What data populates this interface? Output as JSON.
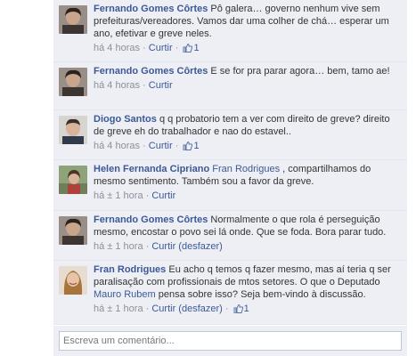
{
  "comments": [
    {
      "author": "Fernando Gomes Côrtes",
      "text": " Pô galera… governo nenhum vive sem prefeituras/vereadores. Vamos dar uma colher de chá… esperar um ano, efetivar e greve neles.",
      "time": "há 4 horas",
      "sep": " · ",
      "action": "Curtir",
      "likes": "1",
      "avatar": "man-dark-hair"
    },
    {
      "author": "Fernando Gomes Côrtes",
      "text": " E se for pra parar agora… bem, tamo ae!",
      "time": "há 4 horas",
      "sep": " · ",
      "action": "Curtir",
      "likes": "",
      "avatar": "man-dark-hair"
    },
    {
      "author": "Diogo Santos",
      "text": " q q probatorio tem a ver com direito de greve? direito de greve eh do trabalhador e nao do estavel..",
      "time": "há 4 horas",
      "sep": " · ",
      "action": "Curtir",
      "likes": "1",
      "avatar": "man-light"
    },
    {
      "author": "Helen Fernanda Cipriano",
      "mention": "Fran Rodrigues",
      "text": " , compartilhamos do mesmo sentimento. Também sou a favor da greve.",
      "time": "há ± 1 hora",
      "sep": " · ",
      "action": "Curtir",
      "likes": "",
      "avatar": "woman-outdoor"
    },
    {
      "author": "Fernando Gomes Côrtes",
      "text": " Normalmente o que rola é perseguição mesmo, encostar o povo sei lá onde. Que se foda. Bora parar tudo.",
      "time": "há ± 1 hora",
      "sep": " · ",
      "action": "Curtir (desfazer)",
      "likes": "",
      "avatar": "man-dark-hair"
    },
    {
      "author": "Fran Rodrigues",
      "text_before": " Eu acho q temos q fazer mesmo, mas aí teria q ser paralisação com profissionais de mtos setores. O que o Deputado ",
      "mention": "Mauro Rubem",
      "text_after": " pensa sobre isso? Seja bem-vindo à discussão.",
      "time": "há ± 1 hora",
      "sep": " · ",
      "action": "Curtir (desfazer)",
      "likes": "1",
      "avatar": "woman-smiling"
    }
  ],
  "write_comment": {
    "placeholder": "Escreva um comentário..."
  },
  "colors": {
    "link": "#3b5998",
    "comment_bg": "#edeff4",
    "meta": "#8a8f9c"
  }
}
